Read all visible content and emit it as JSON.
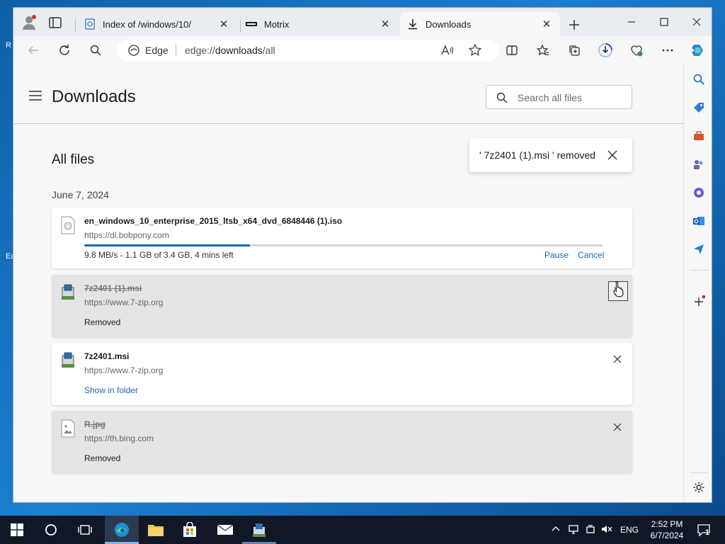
{
  "browser": {
    "tabs": [
      {
        "title": "Index of /windows/10/"
      },
      {
        "title": "Motrix"
      },
      {
        "title": "Downloads"
      }
    ],
    "address": {
      "brand": "Edge",
      "url_scheme": "edge://",
      "url_host": "downloads",
      "url_path": "/all"
    }
  },
  "page": {
    "title": "Downloads",
    "search_placeholder": "Search all files",
    "section_title": "All files",
    "date_group": "June 7, 2024",
    "toast": "' 7z2401 (1).msi ' removed"
  },
  "downloads": [
    {
      "name": "en_windows_10_enterprise_2015_ltsb_x64_dvd_6848446 (1).iso",
      "source": "https://dl.bobpony.com",
      "status": "9.8 MB/s - 1.1 GB of 3.4 GB, 4 mins left",
      "progress": 0.32,
      "pause_label": "Pause",
      "cancel_label": "Cancel"
    },
    {
      "name": "7z2401 (1).msi",
      "source": "https://www.7-zip.org",
      "status": "Removed"
    },
    {
      "name": "7z2401.msi",
      "source": "https://www.7-zip.org",
      "link": "Show in folder"
    },
    {
      "name": "R.jpg",
      "source": "https://th.bing.com",
      "status": "Removed"
    }
  ],
  "taskbar": {
    "lang": "ENG",
    "time": "2:52 PM",
    "date": "6/7/2024",
    "notifications": "1"
  },
  "colors": {
    "accent": "#1a67b8",
    "taskbar": "#101828",
    "removed_card": "#e4e4e4"
  }
}
